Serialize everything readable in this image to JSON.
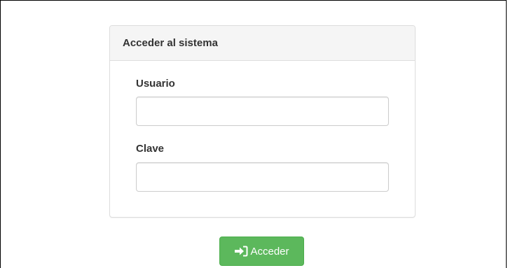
{
  "login_panel": {
    "title": "Acceder al sistema",
    "username": {
      "label": "Usuario",
      "value": "",
      "placeholder": ""
    },
    "password": {
      "label": "Clave",
      "value": "",
      "placeholder": ""
    }
  },
  "submit_button": {
    "label": "Acceder",
    "icon": "sign-in-icon",
    "color": "#5cb85c"
  }
}
